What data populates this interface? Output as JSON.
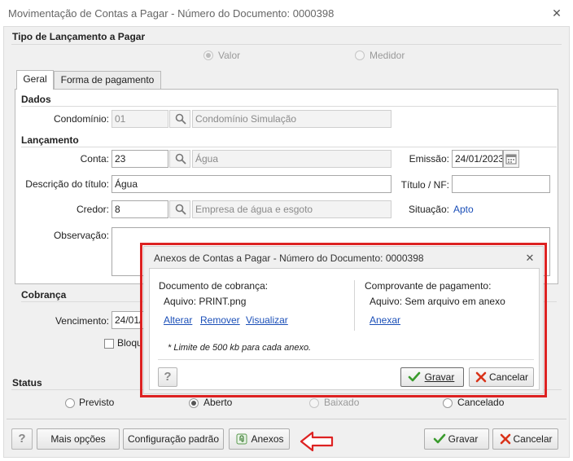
{
  "window": {
    "title": "Movimentação de Contas a Pagar - Número do Documento: 0000398",
    "close_glyph": "✕"
  },
  "tipo": {
    "label": "Tipo de Lançamento a Pagar",
    "options": [
      {
        "label": "Valor",
        "checked": true
      },
      {
        "label": "Medidor",
        "checked": false
      }
    ]
  },
  "tabs": [
    {
      "label": "Geral",
      "active": true
    },
    {
      "label": "Forma de pagamento",
      "active": false
    }
  ],
  "dados": {
    "section": "Dados",
    "condominio_label": "Condomínio:",
    "condominio_code": "01",
    "condominio_name": "Condomínio Simulação"
  },
  "lancamento": {
    "section": "Lançamento",
    "conta_label": "Conta:",
    "conta_code": "23",
    "conta_name": "Água",
    "emissao_label": "Emissão:",
    "emissao_value": "24/01/2023",
    "descricao_label": "Descrição do título:",
    "descricao_value": "Água",
    "titulo_label": "Título / NF:",
    "titulo_value": "",
    "credor_label": "Credor:",
    "credor_code": "8",
    "credor_name": "Empresa de água e esgoto",
    "situacao_label": "Situação:",
    "situacao_value": "Apto",
    "observacao_label": "Observação:"
  },
  "cobranca": {
    "section": "Cobrança",
    "vencimento_label": "Vencimento:",
    "vencimento_value": "24/01/",
    "bloqueio_label": "Bloqu"
  },
  "status": {
    "section": "Status",
    "options": [
      {
        "label": "Previsto",
        "checked": false
      },
      {
        "label": "Aberto",
        "checked": true
      },
      {
        "label": "Baixado",
        "checked": false
      },
      {
        "label": "Cancelado",
        "checked": false
      }
    ]
  },
  "footer": {
    "help": "?",
    "mais_opcoes": "Mais opções",
    "config_padrao": "Configuração padrão",
    "anexos": "Anexos",
    "gravar": "Gravar",
    "cancelar": "Cancelar"
  },
  "modal": {
    "title": "Anexos de Contas a Pagar - Número do Documento: 0000398",
    "close_glyph": "✕",
    "cobranca_label": "Documento de cobrança:",
    "cobranca_file": "Aquivo: PRINT.png",
    "alterar": "Alterar",
    "remover": "Remover",
    "visualizar": "Visualizar",
    "pagamento_label": "Comprovante de pagamento:",
    "pagamento_file": "Aquivo: Sem arquivo em anexo",
    "anexar": "Anexar",
    "limit_note": "* Limite de 500 kb para cada anexo.",
    "help": "?",
    "gravar": "Gravar",
    "cancelar": "Cancelar"
  },
  "colors": {
    "highlight_red": "#dd2222",
    "link_blue": "#1b4fb8",
    "check_green": "#3a9b2d",
    "cancel_red": "#d9331a"
  }
}
